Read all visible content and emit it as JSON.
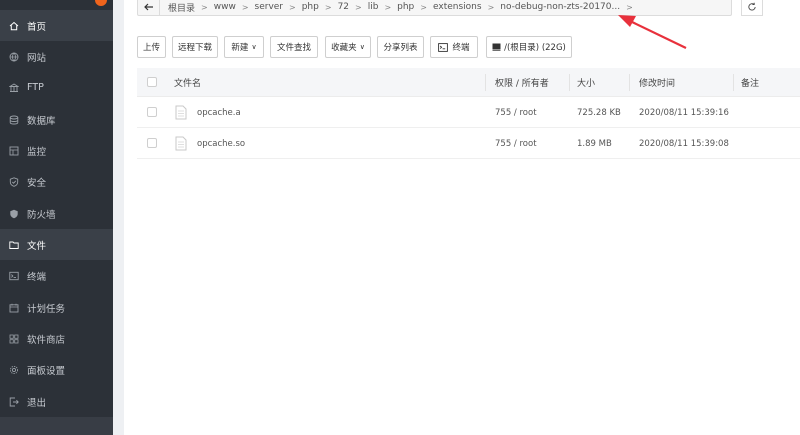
{
  "sidebar": {
    "items": [
      {
        "label": "首页",
        "icon": "home-icon",
        "active": true
      },
      {
        "label": "网站",
        "icon": "globe-icon"
      },
      {
        "label": "FTP",
        "icon": "ftp-icon"
      },
      {
        "label": "数据库",
        "icon": "database-icon"
      },
      {
        "label": "监控",
        "icon": "monitor-icon"
      },
      {
        "label": "安全",
        "icon": "shield-icon"
      },
      {
        "label": "防火墙",
        "icon": "firewall-icon"
      },
      {
        "label": "文件",
        "icon": "folder-icon",
        "active": true
      },
      {
        "label": "终端",
        "icon": "terminal-icon"
      },
      {
        "label": "计划任务",
        "icon": "calendar-icon"
      },
      {
        "label": "软件商店",
        "icon": "grid-icon"
      },
      {
        "label": "面板设置",
        "icon": "gear-icon"
      },
      {
        "label": "退出",
        "icon": "logout-icon"
      }
    ]
  },
  "path": {
    "crumbs": [
      "根目录",
      "www",
      "server",
      "php",
      "72",
      "lib",
      "php",
      "extensions",
      "no-debug-non-zts-20170..."
    ]
  },
  "toolbar": {
    "upload": "上传",
    "remote_download": "远程下载",
    "new": "新建",
    "file_search": "文件查找",
    "favorites": "收藏夹",
    "share_list": "分享列表",
    "terminal": "终端",
    "disk": "/(根目录) (22G)"
  },
  "table": {
    "headers": {
      "name": "文件名",
      "perm": "权限 / 所有者",
      "size": "大小",
      "mtime": "修改时间",
      "note": "备注"
    },
    "rows": [
      {
        "name": "opcache.a",
        "perm": "755 / root",
        "size": "725.28 KB",
        "mtime": "2020/08/11 15:39:16"
      },
      {
        "name": "opcache.so",
        "perm": "755 / root",
        "size": "1.89 MB",
        "mtime": "2020/08/11 15:39:08"
      }
    ]
  },
  "colors": {
    "sidebar_bg": "#2c3138",
    "sidebar_active": "#3a4048",
    "arrow": "#e8313c",
    "badge": "#f0641c"
  }
}
